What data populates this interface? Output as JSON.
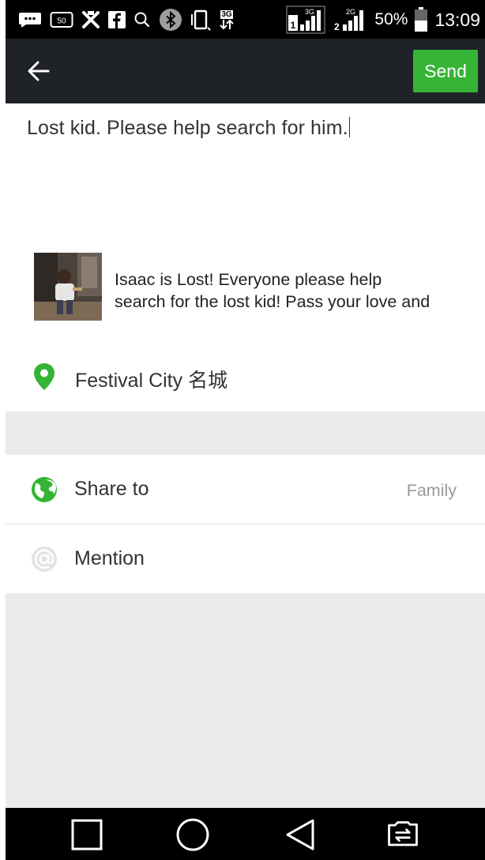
{
  "status_bar": {
    "battery_percent": "50%",
    "time": "13:09",
    "network_3g": "3G",
    "network_2g": "2G",
    "icons": [
      "message-icon",
      "box-50-icon",
      "tools-icon",
      "facebook-icon",
      "search-icon",
      "bluetooth-icon",
      "phone-icon",
      "data-transfer-icon",
      "signal-1-icon",
      "signal-2-icon",
      "battery-icon"
    ]
  },
  "header": {
    "back_icon": "arrow-left-icon",
    "send_label": "Send"
  },
  "compose": {
    "text": "Lost kid. Please help search for him."
  },
  "link_card": {
    "line1": "Isaac is Lost! Everyone please help",
    "line2": "search for the lost kid! Pass your love and"
  },
  "location": {
    "icon": "location-pin-icon",
    "label": "Festival City 名城"
  },
  "share_to": {
    "icon": "globe-icon",
    "label": "Share to",
    "value": "Family"
  },
  "mention": {
    "icon": "at-icon",
    "label": "Mention"
  },
  "navbar": {
    "icons": [
      "recent-apps-icon",
      "home-icon",
      "back-icon",
      "switch-sim-icon"
    ]
  },
  "colors": {
    "accent_green": "#35b436",
    "header_bg": "#1f2227",
    "section_gray": "#ebebeb"
  }
}
